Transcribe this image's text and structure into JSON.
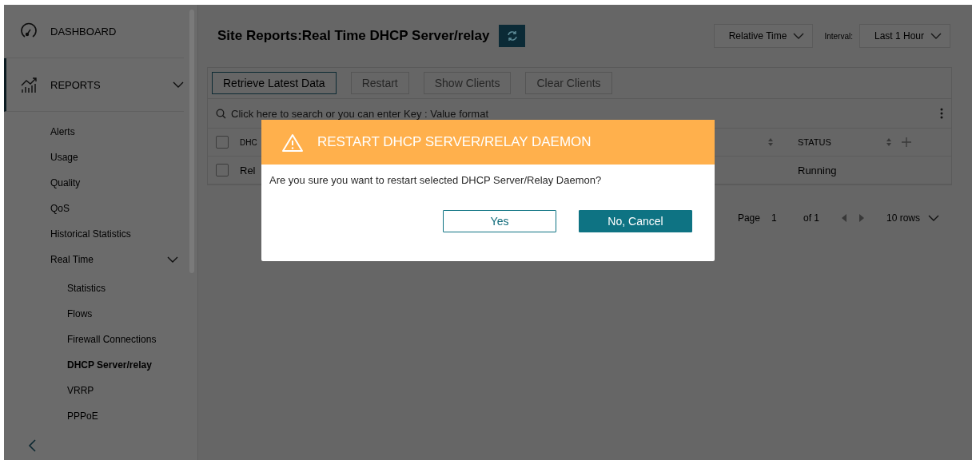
{
  "sidebar": {
    "items": [
      {
        "label": "DASHBOARD",
        "selected": false
      },
      {
        "label": "REPORTS",
        "selected": true,
        "expanded": true,
        "children": [
          {
            "label": "Alerts",
            "selected": false
          },
          {
            "label": "Usage",
            "selected": false
          },
          {
            "label": "Quality",
            "selected": false
          },
          {
            "label": "QoS",
            "selected": false
          },
          {
            "label": "Historical Statistics",
            "selected": false
          },
          {
            "label": "Real Time",
            "selected": false,
            "expanded": true,
            "children": [
              {
                "label": "Statistics",
                "selected": false
              },
              {
                "label": "Flows",
                "selected": false
              },
              {
                "label": "Firewall Connections",
                "selected": false
              },
              {
                "label": "DHCP Server/relay",
                "selected": true
              },
              {
                "label": "VRRP",
                "selected": false
              },
              {
                "label": "PPPoE",
                "selected": false
              }
            ]
          }
        ]
      }
    ]
  },
  "header": {
    "title": "Site Reports:Real Time DHCP Server/relay",
    "time_mode": "Relative Time",
    "interval_label": "Interval:",
    "interval": "Last 1 Hour"
  },
  "toolbar": [
    {
      "label": "Retrieve Latest Data",
      "disabled": false
    },
    {
      "label": "Restart",
      "disabled": true
    },
    {
      "label": "Show Clients",
      "disabled": true
    },
    {
      "label": "Clear Clients",
      "disabled": true
    }
  ],
  "search": {
    "placeholder": "Click here to search or you can enter Key : Value format"
  },
  "table": {
    "all_checked": false,
    "columns": [
      {
        "label": "DHC"
      },
      {
        "label": "STATUS"
      }
    ],
    "rows": [
      {
        "checked": false,
        "cells": [
          "Rel",
          "Running"
        ]
      }
    ]
  },
  "pagination": {
    "page_label": "Page",
    "page": "1",
    "of": "of 1",
    "rows": "10 rows"
  },
  "dialog": {
    "title": "RESTART DHCP SERVER/RELAY DAEMON",
    "message": "Are you sure you want to restart selected DHCP Server/Relay Daemon?",
    "buttons": [
      {
        "label": "Yes",
        "kind": "secondary"
      },
      {
        "label": "No, Cancel",
        "kind": "primary"
      }
    ]
  }
}
